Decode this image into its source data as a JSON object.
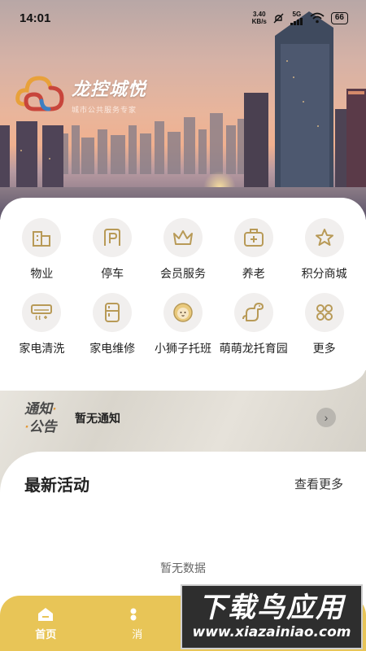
{
  "status_bar": {
    "time": "14:01",
    "net_speed_value": "3.40",
    "net_speed_unit": "KB/s",
    "signal_label": "5G",
    "battery": "66"
  },
  "brand": {
    "title": "龙控城悦",
    "subtitle": "城市公共服务专家"
  },
  "services": [
    {
      "label": "物业",
      "icon": "building-icon"
    },
    {
      "label": "停车",
      "icon": "parking-icon"
    },
    {
      "label": "会员服务",
      "icon": "crown-icon"
    },
    {
      "label": "养老",
      "icon": "medical-kit-icon"
    },
    {
      "label": "积分商城",
      "icon": "star-icon"
    },
    {
      "label": "家电清洗",
      "icon": "air-conditioner-icon"
    },
    {
      "label": "家电维修",
      "icon": "refrigerator-icon"
    },
    {
      "label": "小狮子托班",
      "icon": "lion-icon"
    },
    {
      "label": "萌萌龙托育园",
      "icon": "dinosaur-icon"
    },
    {
      "label": "更多",
      "icon": "more-grid-icon"
    }
  ],
  "notice": {
    "badge_line1": "通知",
    "badge_line2": "公告",
    "text": "暂无通知"
  },
  "activity": {
    "title": "最新活动",
    "more": "查看更多",
    "empty": "暂无数据"
  },
  "bottom_nav": {
    "home": "首页",
    "second": "消"
  },
  "watermark": {
    "line1": "下载鸟应用",
    "line2": "www.xiazainiao.com"
  },
  "colors": {
    "accent": "#e8c557",
    "icon_tint": "#b89a57"
  }
}
